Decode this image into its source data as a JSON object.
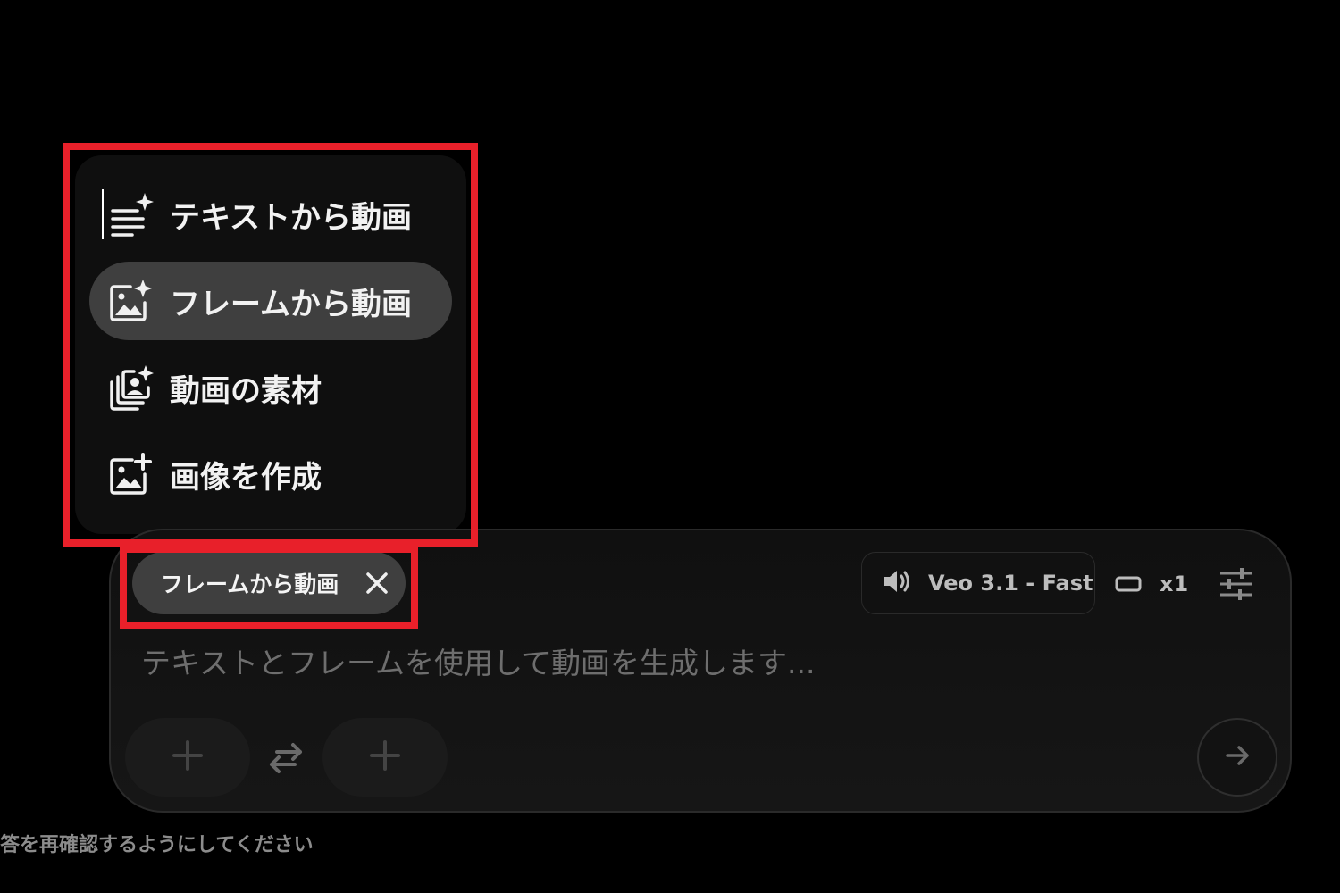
{
  "mode_menu": {
    "items": [
      {
        "label": "テキストから動画",
        "icon": "text-sparkle-icon"
      },
      {
        "label": "フレームから動画",
        "icon": "image-sparkle-icon",
        "selected": true
      },
      {
        "label": "動画の素材",
        "icon": "ingredients-sparkle-icon"
      },
      {
        "label": "画像を作成",
        "icon": "image-plus-icon"
      }
    ]
  },
  "composer": {
    "mode_chip": {
      "label": "フレームから動画",
      "close_icon": "close-icon"
    },
    "model": {
      "label": "Veo 3.1 - Fast",
      "icon": "speaker-icon"
    },
    "aspect_icon": "aspect-ratio-icon",
    "count": "x1",
    "settings_icon": "sliders-icon",
    "prompt": {
      "value": "",
      "placeholder": "テキストとフレームを使用して動画を生成します..."
    },
    "start_frame_icon": "plus-icon",
    "swap_icon": "swap-icon",
    "end_frame_icon": "plus-icon",
    "send_icon": "arrow-right-icon"
  },
  "disclaimer": "答を再確認するようにしてください",
  "colors": {
    "background": "#000000",
    "menu": "#0f0f0f",
    "selected": "#3f3f3f",
    "highlight": "#e8202a"
  }
}
